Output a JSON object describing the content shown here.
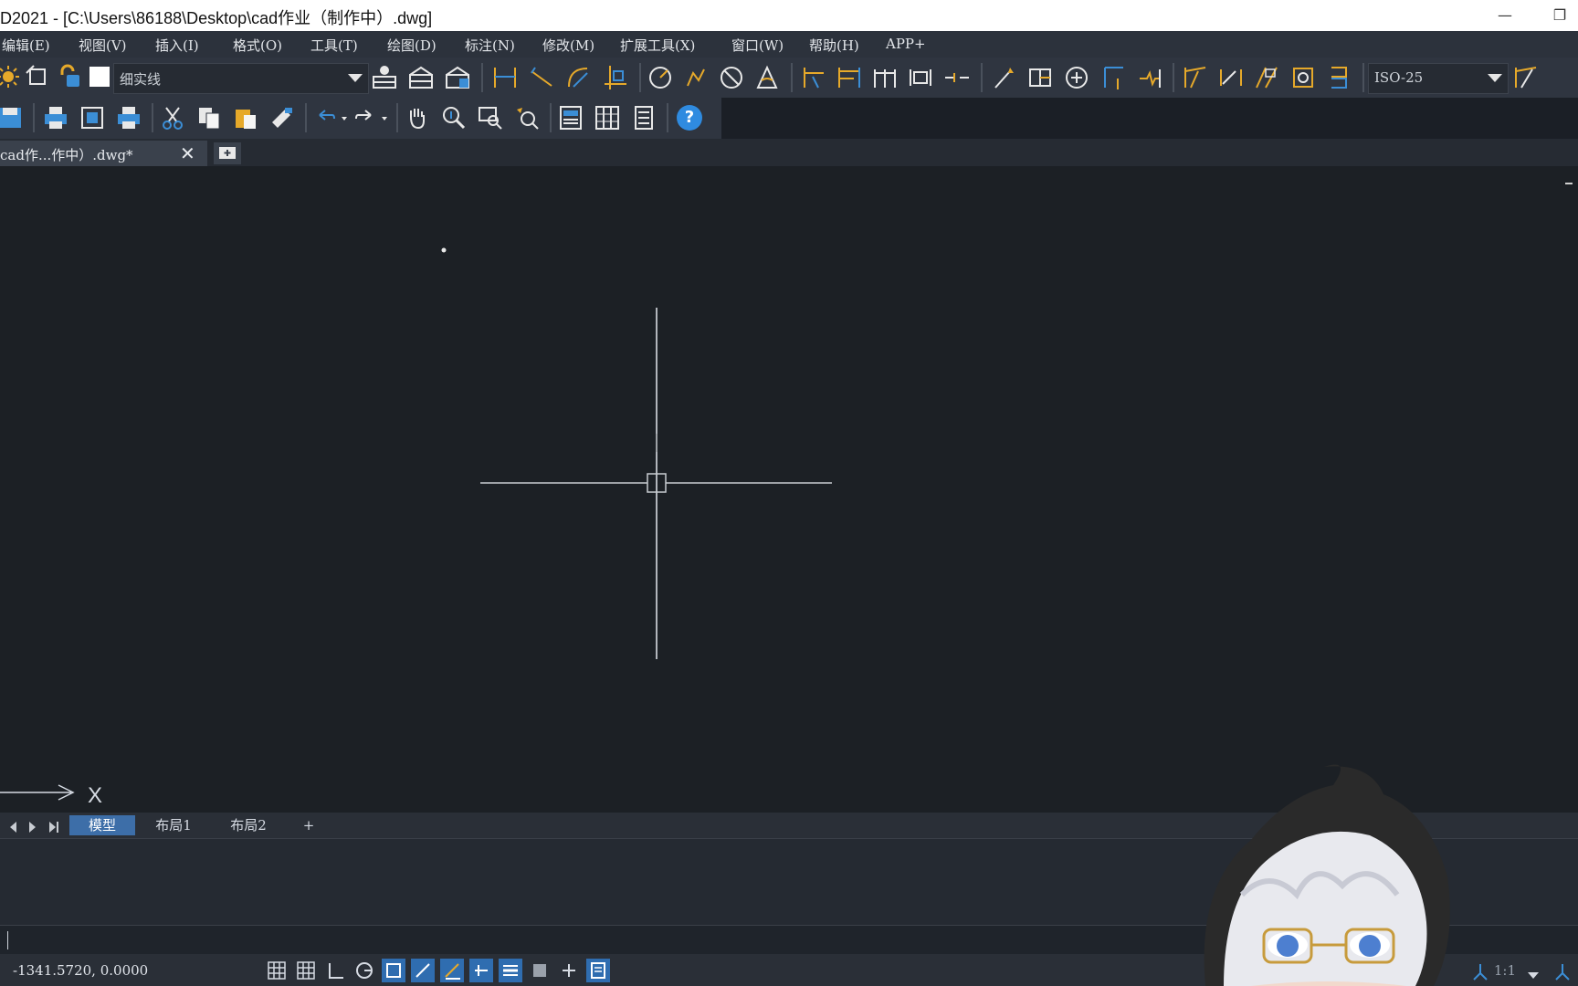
{
  "window": {
    "title": "D2021 - [C:\\Users\\86188\\Desktop\\cad作业（制作中）.dwg]",
    "minimize_label": "—",
    "restore_label": "❐"
  },
  "menu": {
    "items": [
      "编辑(E)",
      "视图(V)",
      "插入(I)",
      "格式(O)",
      "工具(T)",
      "绘图(D)",
      "标注(N)",
      "修改(M)",
      "扩展工具(X)",
      "窗口(W)",
      "帮助(H)",
      "APP+"
    ]
  },
  "toolbar": {
    "linetype_value": "细实线",
    "dimstyle_value": "ISO-25",
    "help_label": "?"
  },
  "document_tabs": {
    "active_label": "cad作...作中）.dwg*",
    "close_label": "✕"
  },
  "canvas": {
    "axis_label": "X"
  },
  "layout_tabs": {
    "items": [
      "模型",
      "布局1",
      "布局2",
      "+"
    ]
  },
  "status": {
    "coordinates": "-1341.5720,  0.0000",
    "scale": "1:1"
  },
  "colors": {
    "accent_blue": "#2f6db0",
    "icon_gold": "#e6a92a",
    "canvas_bg": "#1c2025"
  }
}
